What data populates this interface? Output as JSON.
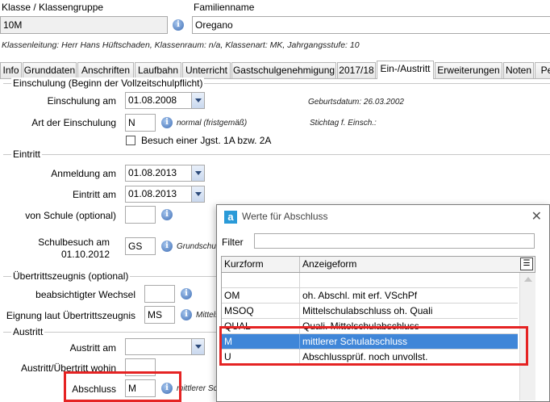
{
  "header": {
    "klasse_label": "Klasse / Klassengruppe",
    "klasse_value": "10M",
    "familienname_label": "Familienname",
    "familienname_value": "Oregano",
    "info_line": "Klassenleitung: Herr Hans Hüftschaden, Klassenraum: n/a, Klassenart: MK, Jahrgangsstufe: 10"
  },
  "tabs": [
    "Info",
    "Grunddaten",
    "Anschriften",
    "Laufbahn",
    "Unterricht",
    "Gastschulgenehmigung",
    "2017/18",
    "Ein-/Austritt",
    "Erweiterungen",
    "Noten",
    "Pe"
  ],
  "einschulung": {
    "section_title": "Einschulung (Beginn der Vollzeitschulpflicht)",
    "einschulung_am_label": "Einschulung am",
    "einschulung_am_value": "01.08.2008",
    "geburtsdatum": "Geburtsdatum: 26.03.2002",
    "art_label": "Art der Einschulung",
    "art_value": "N",
    "art_desc": "normal (fristgemäß)",
    "stichtag": "Stichtag f. Einsch.:",
    "besuch_label": "Besuch einer Jgst. 1A bzw. 2A"
  },
  "eintritt": {
    "section_title": "Eintritt",
    "anmeldung_label": "Anmeldung am",
    "anmeldung_value": "01.08.2013",
    "eintritt_label": "Eintritt am",
    "eintritt_value": "01.08.2013",
    "von_schule_label": "von Schule (optional)",
    "schulbesuch_label_1": "Schulbesuch am",
    "schulbesuch_label_2": "01.10.2012",
    "schulbesuch_value": "GS",
    "schulbesuch_desc": "Grundschu"
  },
  "uebertritt": {
    "section_title": "Übertrittszeugnis (optional)",
    "wechsel_label": "beabsichtigter Wechsel",
    "eignung_label": "Eignung laut Übertrittszeugnis",
    "eignung_value": "MS",
    "eignung_desc": "Mittels"
  },
  "austritt": {
    "section_title": "Austritt",
    "austritt_am_label": "Austritt am",
    "wohin_label": "Austritt/Übertritt wohin",
    "abschluss_label": "Abschluss",
    "abschluss_value": "M",
    "abschluss_desc": "mittlerer Sc"
  },
  "dialog": {
    "app_icon_letter": "a",
    "title": "Werte für Abschluss",
    "filter_label": "Filter",
    "filter_value": "",
    "col_kurzform": "Kurzform",
    "col_anzeigeform": "Anzeigeform",
    "rows": [
      {
        "kurz": "",
        "anzeige": ""
      },
      {
        "kurz": "OM",
        "anzeige": "oh. Abschl. mit erf. VSchPf"
      },
      {
        "kurz": "MSOQ",
        "anzeige": "Mittelschulabschluss oh. Quali"
      },
      {
        "kurz": "QUAL",
        "anzeige": "Quali. Mittelschulabschluss"
      },
      {
        "kurz": "M",
        "anzeige": "mittlerer Schulabschluss"
      },
      {
        "kurz": "U",
        "anzeige": "Abschlussprüf. noch unvollst."
      }
    ],
    "selected_index": 4
  },
  "colors": {
    "selection": "#3f86d8",
    "highlight_box": "#e52323",
    "info_icon": "#3f6eb5"
  },
  "icons": {
    "info": "info-icon",
    "dropdown": "chevron-down-icon",
    "close": "close-icon",
    "column_chooser": "column-chooser-icon",
    "app": "app-icon"
  }
}
